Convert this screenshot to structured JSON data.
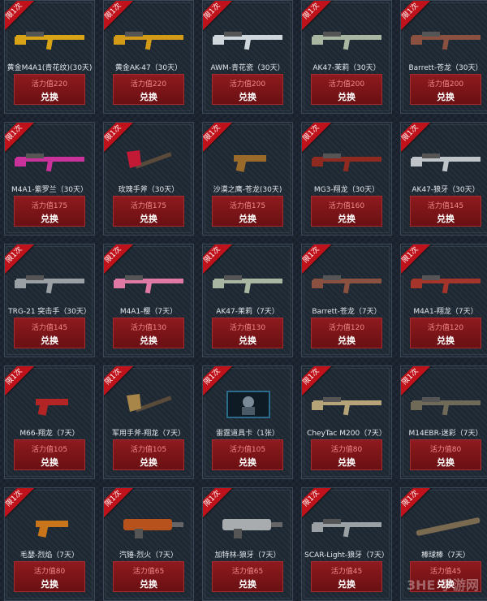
{
  "ribbon_label": "限1次",
  "button_label": "兑换",
  "watermark": "3HE 手游网",
  "colors": {
    "background": "#1b2430",
    "ribbon": "#c0121a",
    "button": "#8e1a1e",
    "cost_text": "#f08a8a"
  },
  "items": [
    {
      "name": "黄金M4A1(青花纹)(30天)",
      "cost": "活力值220",
      "icon": "rifle-gold-icon",
      "color": "#d8a416"
    },
    {
      "name": "黄金AK-47（30天）",
      "cost": "活力值220",
      "icon": "ak-gold-icon",
      "color": "#d39a18"
    },
    {
      "name": "AWM-青花瓷（30天）",
      "cost": "活力值200",
      "icon": "sniper-icon",
      "color": "#cfd6dc"
    },
    {
      "name": "AK47-茉莉（30天）",
      "cost": "活力值200",
      "icon": "ak-floral-icon",
      "color": "#a9b7a2"
    },
    {
      "name": "Barrett-苍龙（30天）",
      "cost": "活力值200",
      "icon": "barrett-icon",
      "color": "#8a5040"
    },
    {
      "name": "M4A1-紫罗兰（30天）",
      "cost": "活力值175",
      "icon": "rifle-pink-icon",
      "color": "#c9329a"
    },
    {
      "name": "玫瑰手斧（30天）",
      "cost": "活力值175",
      "icon": "axe-rose-icon",
      "color": "#c21a34"
    },
    {
      "name": "沙漠之鹰-苍龙(30天)",
      "cost": "活力值175",
      "icon": "pistol-icon",
      "color": "#9a6a2a"
    },
    {
      "name": "MG3-翔龙（30天）",
      "cost": "活力值160",
      "icon": "mg-icon",
      "color": "#8e2a20"
    },
    {
      "name": "AK47-狼牙（30天）",
      "cost": "活力值145",
      "icon": "ak-icon",
      "color": "#bfc4c8"
    },
    {
      "name": "TRG-21 突击手（30天）",
      "cost": "活力值145",
      "icon": "sniper-trg-icon",
      "color": "#9aa0a4"
    },
    {
      "name": "M4A1-樱（7天）",
      "cost": "活力值130",
      "icon": "rifle-sakura-icon",
      "color": "#e07aa4"
    },
    {
      "name": "AK47-茉莉（7天）",
      "cost": "活力值130",
      "icon": "ak-floral-icon",
      "color": "#a9b7a2"
    },
    {
      "name": "Barrett-苍龙（7天）",
      "cost": "活力值120",
      "icon": "barrett-icon",
      "color": "#8a5040"
    },
    {
      "name": "M4A1-翔龙（7天）",
      "cost": "活力值120",
      "icon": "rifle-dragon-icon",
      "color": "#a5342a"
    },
    {
      "name": "M66-翔龙（7天）",
      "cost": "活力值105",
      "icon": "revolver-icon",
      "color": "#b32424"
    },
    {
      "name": "军用手斧-翔龙（7天）",
      "cost": "活力值105",
      "icon": "axe-icon",
      "color": "#a8864a"
    },
    {
      "name": "雷霆道具卡（1张）",
      "cost": "活力值105",
      "icon": "item-card-icon",
      "color": "#2a6a8a"
    },
    {
      "name": "CheyTac M200（7天）",
      "cost": "活力值80",
      "icon": "sniper-cheytac-icon",
      "color": "#b5a478"
    },
    {
      "name": "M14EBR-迷彩（7天）",
      "cost": "活力值80",
      "icon": "rifle-camo-icon",
      "color": "#6f6a58"
    },
    {
      "name": "毛瑟-烈焰（7天）",
      "cost": "活力值80",
      "icon": "mauser-icon",
      "color": "#c8741a"
    },
    {
      "name": "汽锤-烈火（7天）",
      "cost": "活力值65",
      "icon": "hammer-icon",
      "color": "#b8521c"
    },
    {
      "name": "加特林-狼牙（7天）",
      "cost": "活力值65",
      "icon": "gatling-icon",
      "color": "#a8acae"
    },
    {
      "name": "SCAR-Light-狼牙（7天）",
      "cost": "活力值45",
      "icon": "scar-icon",
      "color": "#9aa0a4"
    },
    {
      "name": "棒球棒（7天）",
      "cost": "活力值45",
      "icon": "bat-icon",
      "color": "#7a6a50"
    }
  ]
}
